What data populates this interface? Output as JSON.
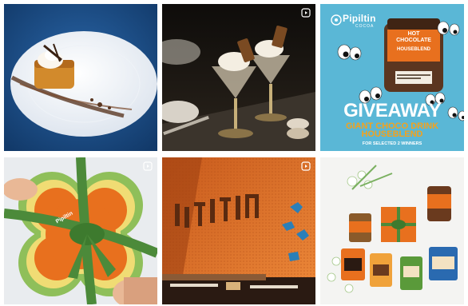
{
  "feed": {
    "tiles": [
      {
        "name": "dessert-plate-post",
        "type": "photo"
      },
      {
        "name": "sundae-glasses-post",
        "type": "reel"
      },
      {
        "name": "giveaway-post",
        "type": "photo",
        "brand": "Pipiltin",
        "brand_sub": "COCOA",
        "jar_label_1": "HOT\nCHOCOLATE",
        "jar_label_2": "HOUSEBLEND",
        "title": "GIVEAWAY",
        "subtitle_1": "GIANT CHOCO DRINK",
        "subtitle_2": "HOUSEBLEND",
        "note": "FOR SELECTED 2 WINNERS"
      },
      {
        "name": "gift-box-post",
        "type": "reel",
        "box_label": "Pipiltin"
      },
      {
        "name": "restaurant-interior-post",
        "type": "reel",
        "sign": "PIPILTIN"
      },
      {
        "name": "products-flatlay-post",
        "type": "photo"
      }
    ]
  },
  "colors": {
    "blue_bg": "#1b4f8c",
    "giveaway_bg": "#5ab7d6",
    "orange": "#e8701e",
    "green_ribbon": "#4c8a3a",
    "brown": "#5a3722"
  },
  "icons": {
    "reel": "reel-icon"
  }
}
